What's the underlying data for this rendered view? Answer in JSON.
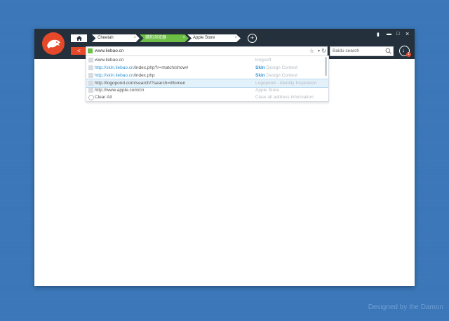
{
  "tabs": [
    {
      "label": "Cheetah",
      "active": false
    },
    {
      "label": "猎豹浏览器",
      "active": true
    },
    {
      "label": "Apple Store",
      "active": false
    }
  ],
  "window_controls": {
    "pin": "▮",
    "minimize": "▬",
    "maximize": "□",
    "close": "×"
  },
  "toolbar": {
    "back_label": "<",
    "new_tab_label": "+"
  },
  "address_bar": {
    "value": "www.liebao.cn",
    "star": "☆",
    "drop": "▾",
    "refresh": "↻"
  },
  "search": {
    "placeholder": "Baidu search"
  },
  "download": {
    "badge": "1"
  },
  "suggestions": [
    {
      "url_hl": "",
      "url": "www.liebao.cn",
      "desc_hl": "",
      "desc": "kingsoft"
    },
    {
      "url_hl": "http://skin.liebao.cn",
      "url": "/index.php?r=match/show#",
      "desc_hl": "Skin",
      "desc": " Design Contest"
    },
    {
      "url_hl": "http://skin.liebao.cn",
      "url": "/index.php",
      "desc_hl": "Skin",
      "desc": " Design Contest"
    },
    {
      "url_hl": "",
      "url": "http://logopond.com/search/?search=Women",
      "desc_hl": "",
      "desc": "Logopond - Identity Inspiration"
    },
    {
      "url_hl": "",
      "url": "http://www.apple.com/cn",
      "desc_hl": "",
      "desc": "Apple Store"
    }
  ],
  "clear": {
    "label": "Clear All",
    "desc": "Clear all address information"
  },
  "credit": "Designed by the Damon",
  "colors": {
    "accent_red": "#e6492a",
    "accent_green": "#6cbe45",
    "topbar": "#24313d",
    "background": "#3a76b8",
    "link": "#2e94d4"
  },
  "icons": {
    "logo": "cheetah-logo-icon",
    "home": "home-icon",
    "search": "search-icon",
    "download": "download-icon"
  }
}
